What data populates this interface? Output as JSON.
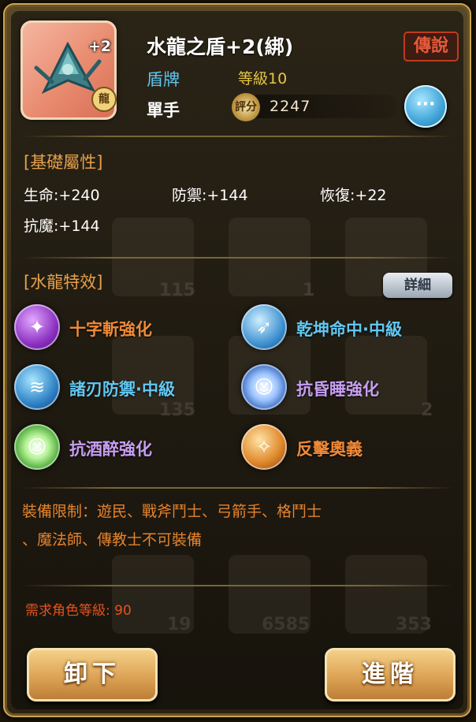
{
  "item": {
    "name": "水龍之盾+2(綁)",
    "plus_badge": "+2",
    "bind_badge": "龍",
    "rarity": "傳說",
    "type": "盾牌",
    "level_label": "等級10",
    "hand": "單手",
    "score_icon_label": "評分",
    "score": "2247",
    "more_label": "···"
  },
  "base_section": {
    "title": "[基礎屬性]",
    "stats": [
      "生命:+240",
      "防禦:+144",
      "恢復:+22",
      "抗魔:+144"
    ]
  },
  "effect_section": {
    "title": "[水龍特效]",
    "details_label": "詳細",
    "effects": [
      {
        "label": "十字斬強化",
        "icon": "purple-slash-icon",
        "color": "#f08a38"
      },
      {
        "label": "乾坤命中·中級",
        "icon": "blue-strike-icon",
        "color": "#62c8f2"
      },
      {
        "label": "諸刃防禦·中級",
        "icon": "blue-blade-icon",
        "color": "#62c8f2"
      },
      {
        "label": "抗昏睡強化",
        "icon": "blue-figure-icon",
        "color": "#c89ef2"
      },
      {
        "label": "抗酒醉強化",
        "icon": "green-figure-icon",
        "color": "#c89ef2"
      },
      {
        "label": "反擊奧義",
        "icon": "orange-counter-icon",
        "color": "#f08a38"
      }
    ]
  },
  "restriction": {
    "line1": "裝備限制：遊民、戰斧鬥士、弓箭手、格鬥士",
    "line2": "、魔法師、傳教士不可裝備"
  },
  "required_level": "需求角色等級: 90",
  "buttons": {
    "unequip": "卸下",
    "advance": "進階"
  },
  "background_counts": [
    "115",
    "1",
    "135",
    "2",
    "19",
    "6585",
    "353"
  ]
}
